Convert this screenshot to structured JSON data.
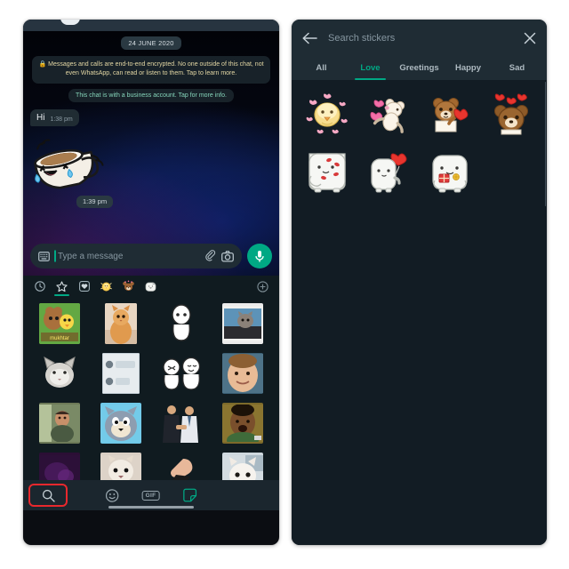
{
  "colors": {
    "accent_teal": "#00a884",
    "highlight_red": "#e8282d",
    "panel_bg_dark": "#121c24",
    "header_bg": "#1f2c34",
    "bubble_bg": "#202c33",
    "encryption_text": "#e3d7a4",
    "business_text": "#86d6bb"
  },
  "left_panel": {
    "name": "whatsapp-chat-screen",
    "chat": {
      "date_divider": "24 JUNE 2020",
      "encryption_notice": "Messages and calls are end-to-end encrypted. No one outside of this chat, not even WhatsApp, can read or listen to them. Tap to learn more.",
      "lock_icon": "lock-icon",
      "business_notice": "This chat is with a business account. Tap for more info.",
      "messages": [
        {
          "type": "text",
          "text": "Hi",
          "time": "1:38 pm"
        },
        {
          "type": "sticker",
          "sticker": "laughing-coffee-cup-sticker",
          "time": "1:39 pm"
        }
      ]
    },
    "composer": {
      "keyboard_icon": "keyboard-icon",
      "placeholder": "Type a message",
      "value": "",
      "attach_icon": "paperclip-icon",
      "camera_icon": "camera-icon",
      "mic_icon": "microphone-icon"
    },
    "sticker_tray": {
      "tabs": [
        {
          "name": "recent-stickers-tab",
          "icon": "clock-icon",
          "active": false
        },
        {
          "name": "favorite-stickers-tab",
          "icon": "star-icon",
          "active": true
        },
        {
          "name": "heart-pack-tab",
          "icon": "heart-square-icon",
          "active": false
        },
        {
          "name": "chick-pack-tab",
          "icon": "yellow-chick-icon",
          "active": false
        },
        {
          "name": "bear-pack-tab",
          "icon": "brown-bear-icon",
          "active": false
        },
        {
          "name": "white-bear-pack-tab",
          "icon": "white-bear-icon",
          "active": false
        }
      ],
      "add_pack_icon": "plus-circle-icon",
      "stickers": [
        "jerry-tweety-meme-sticker",
        "orange-kitten-photo-sticker",
        "white-blob-figure-sticker",
        "cat-in-car-photo-sticker",
        "grey-cat-face-sticker",
        "chat-screenshot-sticker",
        "two-blob-figures-sticker",
        "smirking-child-sticker",
        "man-in-car-sticker",
        "tom-cat-sticker",
        "handshake-meme-sticker",
        "laughing-man-sticker",
        "purple-dark-sticker",
        "cat-clapping-sticker",
        "hand-meme-sticker",
        "white-cat-sticker"
      ]
    },
    "bottom_bar": {
      "search_icon": "search-icon",
      "search_highlighted": true,
      "emoji_icon": "emoji-smiley-icon",
      "gif_label": "GIF",
      "sticker_icon": "sticker-icon",
      "home_indicator": "home-indicator-bar"
    }
  },
  "right_panel": {
    "name": "sticker-search-screen",
    "header": {
      "back_icon": "back-arrow-icon",
      "search_placeholder": "Search stickers",
      "search_value": "",
      "close_icon": "close-x-icon"
    },
    "tabs": [
      {
        "label": "All",
        "active": false
      },
      {
        "label": "Love",
        "active": true
      },
      {
        "label": "Greetings",
        "active": false
      },
      {
        "label": "Happy",
        "active": false
      },
      {
        "label": "Sad",
        "active": false
      }
    ],
    "results": [
      "yellow-chick-with-hearts-sticker",
      "cream-bear-blowing-hearts-sticker",
      "brown-bear-holding-heart-sticker",
      "brown-bear-with-hearts-sticker",
      "white-bear-with-kisses-sticker",
      "white-bear-heart-balloon-sticker",
      "white-bear-with-gift-sticker"
    ],
    "scrollbar": "vertical-scrollbar"
  }
}
